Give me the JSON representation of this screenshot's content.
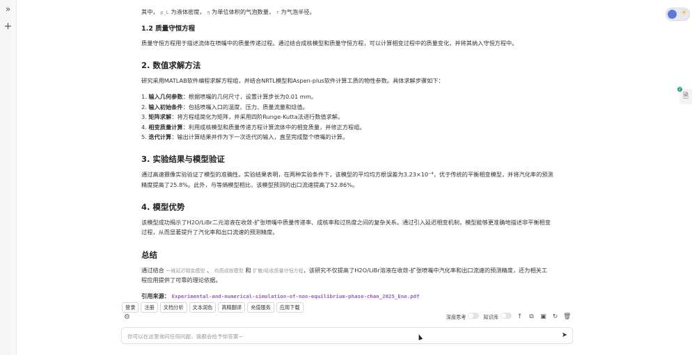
{
  "sidebar": {
    "expand_icon": "double-chevron-right-icon",
    "new_icon": "plus-icon"
  },
  "article": {
    "intro_a": "其中，",
    "sym_rho": "ρ_L",
    "intro_b": "为液体密度，",
    "sym_eta": "η",
    "intro_c": "为单位体积的气泡数量，",
    "sym_r": "r",
    "intro_d": "为气泡半径。",
    "h_mass": "1.2 质量守恒方程",
    "p_mass": "质量守恒方程用于描述流体在喷嘴中的质量传递过程。通过结合成核模型和质量守恒方程，可以计算相变过程中的质量变化，并将其纳入守恒方程中。",
    "h_numeric": "2. 数值求解方法",
    "p_numeric": "研究采用MATLAB软件编程求解方程组，并结合NRTL模型和Aspen-plus软件计算工质的物性参数。具体求解步骤如下：",
    "steps": [
      {
        "num": "1.",
        "title": "输入几何参数",
        "text": "：根据喷嘴的几何尺寸，设置计算步长为0.01 mm。"
      },
      {
        "num": "2.",
        "title": "输入初始条件",
        "text": "：包括喷嘴入口的温度、压力、质量流量和焓值。"
      },
      {
        "num": "3.",
        "title": "矩阵求解",
        "text": "：将方程组简化为矩阵，并采用四阶Runge-Kutta法进行数值求解。"
      },
      {
        "num": "4.",
        "title": "相变质量计算",
        "text": "：利用成核模型和质量传递方程计算流体中的相变质量，并修正方程组。"
      },
      {
        "num": "5.",
        "title": "迭代计算",
        "text": "：输出计算结果并作为下一次迭代的输入，直至完成整个喷嘴的计算。"
      }
    ],
    "h_validation": "3. 实验结果与模型验证",
    "p_validation_1": "通过高速摄像实验验证了模型的准确性。实验结果表明，在两种实验条件下，该模型的平均均方根误差为3.23×10⁻⁴，优于传统的平衡相变模型，并将汽化率的预测",
    "p_validation_2": "精度提高了25.8%。此外，与等熵模型相比，该模型预测的出口流速提高了52.86%。",
    "h_advantage": "4. 模型优势",
    "p_advantage_1": "该模型成功揭示了H2O/LiBr二元溶液在收敛-扩张喷嘴中质量传递率、成核率和过热度之间的复杂关系。通过引入延迟相变机制，模型能够更准确地描述非平衡相变",
    "p_advantage_2": "过程，从而显著提升了汽化率和出口流速的预测精度。",
    "h_summary": "总结",
    "sum_a": "通过结合",
    "cite_1": "一维延迟相变模型",
    "sum_sep1": "、",
    "cite_2": "均质成核模型",
    "sum_and": "和",
    "cite_3": "扩散/吸收质量守恒方程",
    "sum_b": "，该研究不仅提高了H2O/LiBr溶液在收敛-扩张喷嘴中汽化率和出口流速的预测精度，还为相关工",
    "sum_c": "程应用提供了可靠的理论依据。",
    "source_label": "引用来源：",
    "source_file": "Experimental-and-numerical-simulation-of-non-equilibrium-phase-chan_2025_Ene.pdf"
  },
  "chips": [
    "登录",
    "注册",
    "文档分析",
    "文本润色",
    "高精翻译",
    "充值服务",
    "应用下载"
  ],
  "toolbar": {
    "deep_think": "深度思考",
    "knowledge": "知识库",
    "settings_icon": "gear-icon",
    "icons": [
      "upload-icon",
      "copy-icon",
      "image-icon",
      "refresh-icon",
      "trash-icon"
    ]
  },
  "input": {
    "placeholder": "你可以在这里询问任何问题，我都会给予你答案~",
    "send_icon": "send-icon"
  },
  "doc_panel": {
    "badge": "2"
  }
}
